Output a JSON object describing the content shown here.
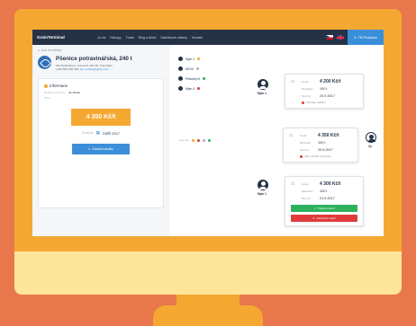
{
  "nav": {
    "logo": "GrainTerminal",
    "links": [
      "Jo ms",
      "Nákupy",
      "Trade",
      "Blog a akcie",
      "Nabídkové odkazy",
      "Kontakt"
    ],
    "login": "TM Produkce"
  },
  "left": {
    "back": "Zpět na nabídky",
    "title": "Pšenice potravinářská, 240 t",
    "address": "Klk 25 Moutkovi, Jirsova 8, 301 00, Frenchtön",
    "contact_phone": "+420 605 048 038,",
    "contact_email": "jan.vodeka@gmail.com",
    "info_title": "Informace",
    "rows": [
      {
        "k": "Dodací podmínky",
        "v": "Ze skladu"
      },
      {
        "k": "DPH",
        "v": ""
      }
    ],
    "price": "4 350 Kč/t",
    "date_label": "Dodat do",
    "date": "ZÁŘÍ 2017",
    "send_button": "Zobrazit nabídky"
  },
  "users": [
    {
      "name": "Mým 1",
      "color": "#f4a832"
    },
    {
      "name": "MO III",
      "color": "#aab3bf"
    },
    {
      "name": "Pekárny III",
      "color": "#2fb15c"
    },
    {
      "name": "Mým 4",
      "color": "#e03b3b"
    }
  ],
  "legend": [
    "Legenda"
  ],
  "bubble1": {
    "avatar_label": "Mým 1",
    "price_label": "Cena",
    "price": "4 200 Kč/t",
    "qty_label": "Množství",
    "qty": "100 t",
    "date_label": "Termín",
    "date": "20.9.2017",
    "status": "Odmítl(a) nabídku"
  },
  "bubble2": {
    "avatar_label": "Vy",
    "price_label": "Cena",
    "price": "4 350 Kč/t",
    "qty_label": "Množství",
    "qty": "100 t",
    "date_label": "Termín",
    "date": "20.9.2017",
    "status": "Vaše nabídka odmítnuta"
  },
  "bubble3": {
    "avatar_label": "Mým 1",
    "price_label": "Cena",
    "price": "4 300 Kč/t",
    "qty_label": "Množství",
    "qty": "100 t",
    "date_label": "Termín",
    "date": "21.9.2017",
    "accept": "Přijmout návrh",
    "reject": "Odmítnout návrh"
  }
}
